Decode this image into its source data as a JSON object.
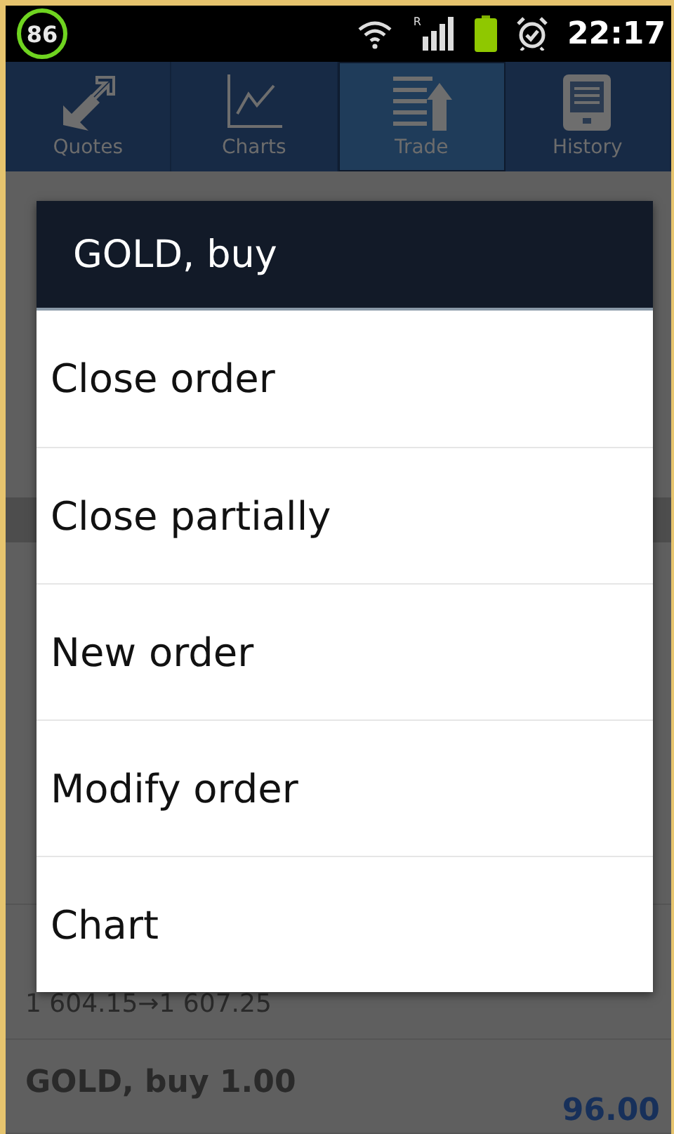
{
  "status_bar": {
    "battery_badge": "86",
    "roaming": "R",
    "time": "22:17"
  },
  "tabs": [
    {
      "label": "Quotes",
      "selected": false
    },
    {
      "label": "Charts",
      "selected": false
    },
    {
      "label": "Trade",
      "selected": true
    },
    {
      "label": "History",
      "selected": false
    }
  ],
  "dialog": {
    "title": "GOLD, buy",
    "items": [
      "Close order",
      "Close partially",
      "New order",
      "Modify order",
      "Chart"
    ]
  },
  "positions": [
    {
      "prices": "1 604.15→1 607.25"
    },
    {
      "title": "GOLD, buy 1.00",
      "profit": "96.00"
    }
  ]
}
